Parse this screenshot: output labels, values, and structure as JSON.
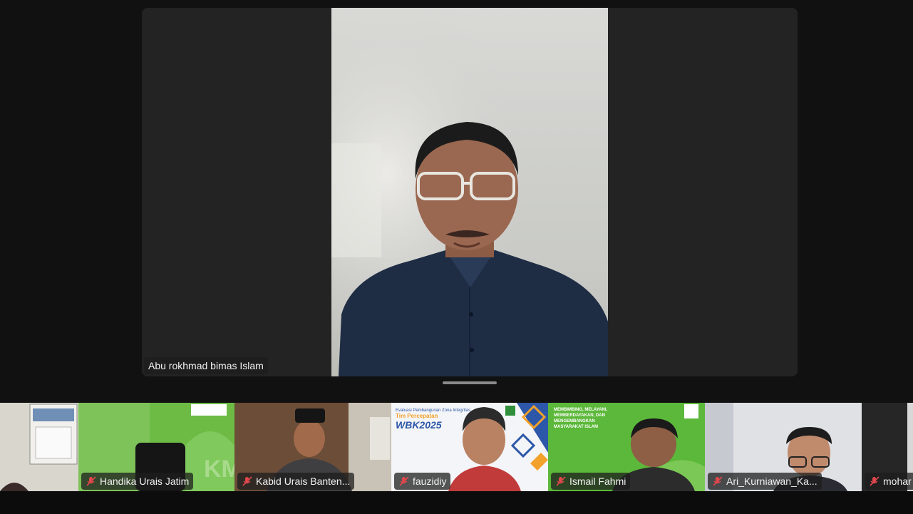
{
  "speaker": {
    "name": "Abu rokhmad bimas Islam"
  },
  "participants": [
    {
      "name": "",
      "muted": false
    },
    {
      "name": "Handika Urais Jatim",
      "muted": true
    },
    {
      "name": "Kabid Urais Banten...",
      "muted": true
    },
    {
      "name": "fauzidiy",
      "muted": true
    },
    {
      "name": "Ismail Fahmi",
      "muted": true
    },
    {
      "name": "Ari_Kurniawan_Ka...",
      "muted": true
    },
    {
      "name": "mohar",
      "muted": true
    }
  ],
  "banners": {
    "jatim_logo": "KM",
    "wbk_line1": "Evaluasi Pembangunan Zona Integritas",
    "wbk_line2": "Tim Percepatan",
    "wbk_main": "WBK2025",
    "ismail_bg": "MEMBIMBING, MELAYANI, MEMBERDAYAKAN, DAN MENGEMBANGKAN MASYARAKAT ISLAM"
  },
  "colors": {
    "mute": "#e0474c",
    "green": "#5cb83a"
  }
}
